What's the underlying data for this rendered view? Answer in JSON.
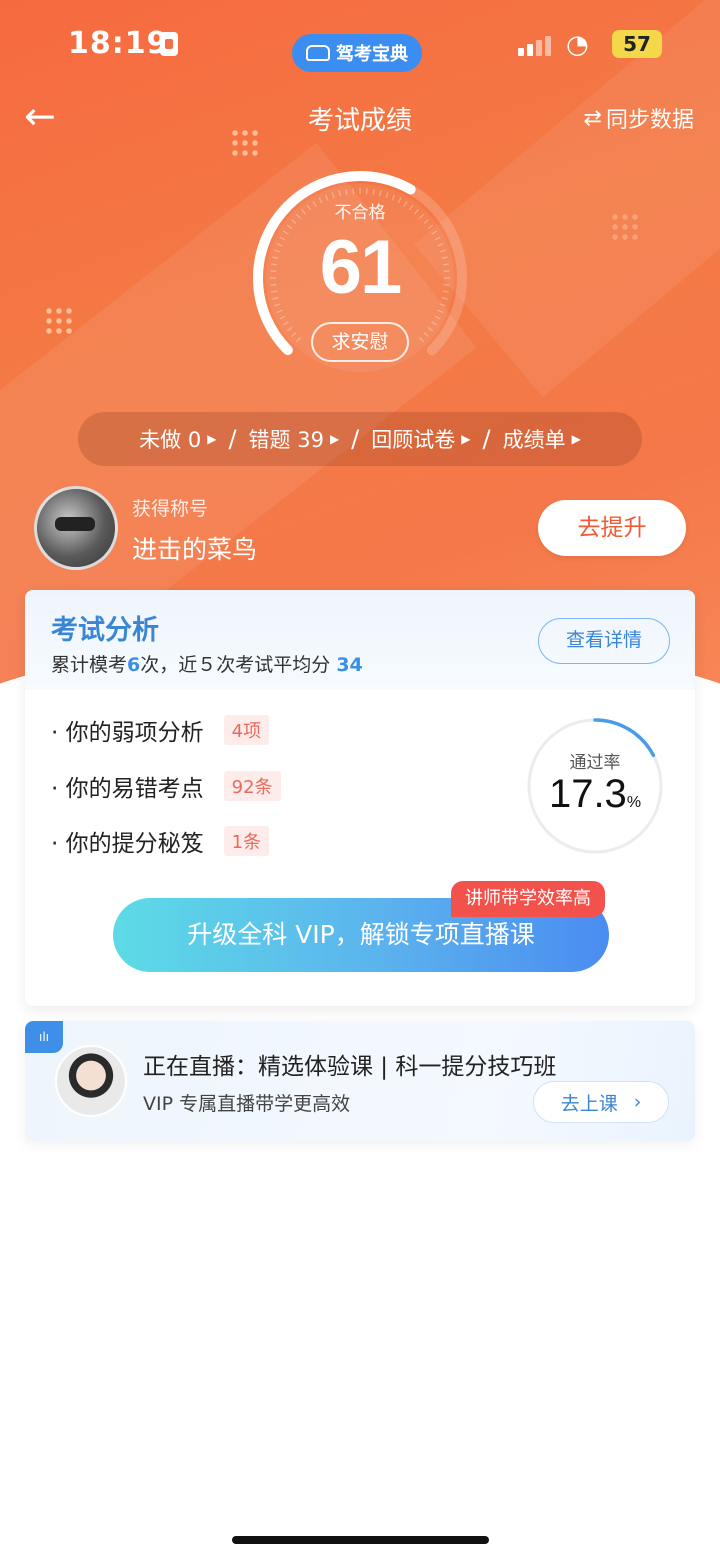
{
  "status_bar": {
    "time": "18:19",
    "battery": "57"
  },
  "app_pill": {
    "label": "驾考宝典"
  },
  "nav": {
    "back": "←",
    "title": "考试成绩",
    "sync": "同步数据",
    "sync_icon": "⇄"
  },
  "score": {
    "status": "不合格",
    "value": "61",
    "button": "求安慰",
    "arc_fraction": 0.61
  },
  "quickbar": {
    "items": [
      {
        "label": "未做 0"
      },
      {
        "label": "错题  39"
      },
      {
        "label": "回顾试卷"
      },
      {
        "label": "成绩单"
      }
    ],
    "separator": "/"
  },
  "user": {
    "title_label": "获得称号",
    "title_value": "进击的菜鸟",
    "improve_button": "去提升"
  },
  "analysis": {
    "title": "考试分析",
    "sub_prefix": "累计模考",
    "mock_count": "6",
    "sub_middle": "次，近５次考试平均分",
    "avg_score": "34",
    "detail_button": "查看详情",
    "rows": [
      {
        "label": "· 你的弱项分析",
        "tag": "4项"
      },
      {
        "label": "· 你的易错考点",
        "tag": "92条"
      },
      {
        "label": "· 你的提分秘笈",
        "tag": "1条"
      }
    ],
    "pass_rate_label": "通过率",
    "pass_rate_value": "17.3",
    "pass_rate_unit": "%",
    "pass_rate_fraction": 0.173,
    "vip_button": "升级全科 VIP，解锁专项直播课",
    "vip_tag": "讲师带学效率高"
  },
  "live": {
    "badge_icon": "audio-bars-icon",
    "title": "正在直播：精选体验课 | 科一提分技巧班",
    "subtitle": "VIP 专属直播带学更高效",
    "button": "去上课"
  },
  "colors": {
    "hero": "#f66a40",
    "accent_blue": "#3a86d4",
    "tag_red": "#e76b5e",
    "vip_tag": "#f2524b"
  }
}
